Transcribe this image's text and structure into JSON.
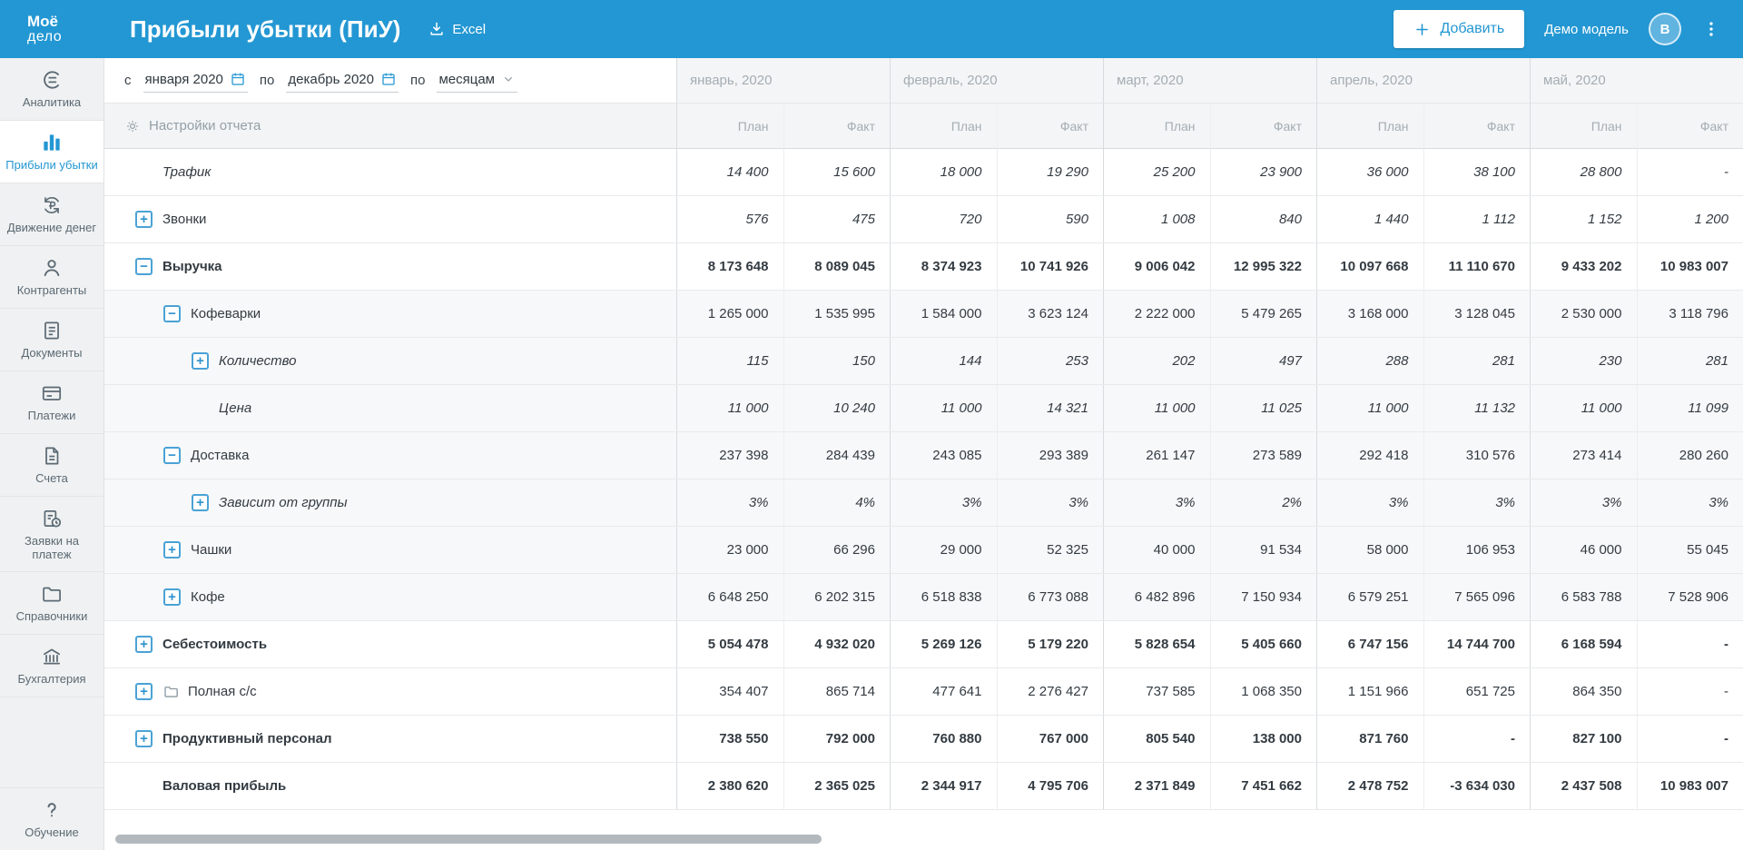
{
  "colors": {
    "accent": "#2397d3"
  },
  "topbar": {
    "logo_line1": "Моё",
    "logo_line2": "дело",
    "title": "Прибыли убытки (ПиУ)",
    "excel_label": "Excel",
    "add_label": "Добавить",
    "account_name": "Демо модель",
    "avatar_initial": "B"
  },
  "sidebar": {
    "items": [
      {
        "id": "analytics",
        "label": "Аналитика",
        "icon": "analytics-icon",
        "active": false
      },
      {
        "id": "profit-loss",
        "label": "Прибыли убытки",
        "icon": "profit-loss-icon",
        "active": true
      },
      {
        "id": "cash-flow",
        "label": "Движение денег",
        "icon": "cash-flow-icon",
        "active": false
      },
      {
        "id": "contractors",
        "label": "Контрагенты",
        "icon": "contractors-icon",
        "active": false
      },
      {
        "id": "documents",
        "label": "Документы",
        "icon": "documents-icon",
        "active": false
      },
      {
        "id": "payments",
        "label": "Платежи",
        "icon": "payments-icon",
        "active": false
      },
      {
        "id": "invoices",
        "label": "Счета",
        "icon": "invoices-icon",
        "active": false
      },
      {
        "id": "payment-requests",
        "label": "Заявки на платеж",
        "icon": "payment-requests-icon",
        "active": false
      },
      {
        "id": "directories",
        "label": "Справочники",
        "icon": "directories-icon",
        "active": false
      },
      {
        "id": "accounting",
        "label": "Бухгалтерия",
        "icon": "accounting-icon",
        "active": false
      },
      {
        "id": "education",
        "label": "Обучение",
        "icon": "education-icon",
        "active": false,
        "bottom": true
      }
    ]
  },
  "filters": {
    "from_label": "с",
    "from_value": "января 2020",
    "to_label": "по",
    "to_value": "декабрь 2020",
    "period_label": "по",
    "period_value": "месяцам",
    "settings_label": "Настройки отчета"
  },
  "table": {
    "months": [
      "январь, 2020",
      "февраль, 2020",
      "март, 2020",
      "апрель, 2020",
      "май, 2020"
    ],
    "subheaders": [
      "План",
      "Факт"
    ],
    "rows": [
      {
        "label": "Трафик",
        "level": 1,
        "expand": null,
        "bold": false,
        "italic_label": true,
        "italic_values": true,
        "values": [
          "14 400",
          "15 600",
          "18 000",
          "19 290",
          "25 200",
          "23 900",
          "36 000",
          "38 100",
          "28 800",
          "-"
        ]
      },
      {
        "label": "Звонки",
        "level": 1,
        "expand": "plus",
        "bold": false,
        "italic_label": false,
        "italic_values": true,
        "values": [
          "576",
          "475",
          "720",
          "590",
          "1 008",
          "840",
          "1 440",
          "1 112",
          "1 152",
          "1 200"
        ]
      },
      {
        "label": "Выручка",
        "level": 1,
        "expand": "minus",
        "bold": true,
        "values": [
          "8 173 648",
          "8 089 045",
          "8 374 923",
          "10 741 926",
          "9 006 042",
          "12 995 322",
          "10 097 668",
          "11 110 670",
          "9 433 202",
          "10 983 007"
        ]
      },
      {
        "label": "Кофеварки",
        "level": 2,
        "expand": "minus",
        "values": [
          "1 265 000",
          "1 535 995",
          "1 584 000",
          "3 623 124",
          "2 222 000",
          "5 479 265",
          "3 168 000",
          "3 128 045",
          "2 530 000",
          "3 118 796"
        ]
      },
      {
        "label": "Количество",
        "level": 3,
        "expand": "plus",
        "italic_label": true,
        "italic_values": true,
        "values": [
          "115",
          "150",
          "144",
          "253",
          "202",
          "497",
          "288",
          "281",
          "230",
          "281"
        ]
      },
      {
        "label": "Цена",
        "level": 3,
        "expand": null,
        "italic_label": true,
        "italic_values": true,
        "values": [
          "11 000",
          "10 240",
          "11 000",
          "14 321",
          "11 000",
          "11 025",
          "11 000",
          "11 132",
          "11 000",
          "11 099"
        ]
      },
      {
        "label": "Доставка",
        "level": 2,
        "expand": "minus",
        "values": [
          "237 398",
          "284 439",
          "243 085",
          "293 389",
          "261 147",
          "273 589",
          "292 418",
          "310 576",
          "273 414",
          "280 260"
        ]
      },
      {
        "label": "Зависит от группы",
        "level": 3,
        "expand": "plus",
        "italic_label": true,
        "italic_values": true,
        "values": [
          "3%",
          "4%",
          "3%",
          "3%",
          "3%",
          "2%",
          "3%",
          "3%",
          "3%",
          "3%"
        ]
      },
      {
        "label": "Чашки",
        "level": 2,
        "expand": "plus",
        "values": [
          "23 000",
          "66 296",
          "29 000",
          "52 325",
          "40 000",
          "91 534",
          "58 000",
          "106 953",
          "46 000",
          "55 045"
        ]
      },
      {
        "label": "Кофе",
        "level": 2,
        "expand": "plus",
        "values": [
          "6 648 250",
          "6 202 315",
          "6 518 838",
          "6 773 088",
          "6 482 896",
          "7 150 934",
          "6 579 251",
          "7 565 096",
          "6 583 788",
          "7 528 906"
        ]
      },
      {
        "label": "Себестоимость",
        "level": 1,
        "expand": "plus",
        "bold": true,
        "values": [
          "5 054 478",
          "4 932 020",
          "5 269 126",
          "5 179 220",
          "5 828 654",
          "5 405 660",
          "6 747 156",
          "14 744 700",
          "6 168 594",
          "-"
        ]
      },
      {
        "label": "Полная с/с",
        "level": 1,
        "expand": "plus",
        "folder": true,
        "values": [
          "354 407",
          "865 714",
          "477 641",
          "2 276 427",
          "737 585",
          "1 068 350",
          "1 151 966",
          "651 725",
          "864 350",
          "-"
        ]
      },
      {
        "label": "Продуктивный персонал",
        "level": 1,
        "expand": "plus",
        "bold": true,
        "values": [
          "738 550",
          "792 000",
          "760 880",
          "767 000",
          "805 540",
          "138 000",
          "871 760",
          "-",
          "827 100",
          "-"
        ]
      },
      {
        "label": "Валовая прибыль",
        "level": 1,
        "expand": null,
        "bold": true,
        "values": [
          "2 380 620",
          "2 365 025",
          "2 344 917",
          "4 795 706",
          "2 371 849",
          "7 451 662",
          "2 478 752",
          "-3 634 030",
          "2 437 508",
          "10 983 007"
        ]
      }
    ]
  }
}
